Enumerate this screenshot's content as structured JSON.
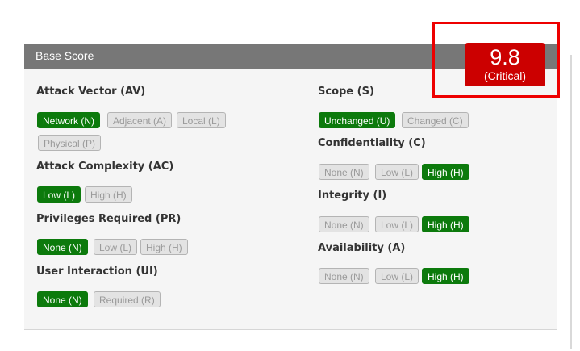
{
  "panel": {
    "title": "Base Score"
  },
  "score": {
    "value": "9.8",
    "severity": "(Critical)"
  },
  "metrics": {
    "attack_vector": {
      "label": "Attack Vector (AV)",
      "options": [
        "Network (N)",
        "Adjacent (A)",
        "Local (L)",
        "Physical (P)"
      ],
      "selected": "Network (N)"
    },
    "attack_complexity": {
      "label": "Attack Complexity (AC)",
      "options": [
        "Low (L)",
        "High (H)"
      ],
      "selected": "Low (L)"
    },
    "privileges_required": {
      "label": "Privileges Required (PR)",
      "options": [
        "None (N)",
        "Low (L)",
        "High (H)"
      ],
      "selected": "None (N)"
    },
    "user_interaction": {
      "label": "User Interaction (UI)",
      "options": [
        "None (N)",
        "Required (R)"
      ],
      "selected": "None (N)"
    },
    "scope": {
      "label": "Scope (S)",
      "options": [
        "Unchanged (U)",
        "Changed (C)"
      ],
      "selected": "Unchanged (U)"
    },
    "confidentiality": {
      "label": "Confidentiality (C)",
      "options": [
        "None (N)",
        "Low (L)",
        "High (H)"
      ],
      "selected": "High (H)"
    },
    "integrity": {
      "label": "Integrity (I)",
      "options": [
        "None (N)",
        "Low (L)",
        "High (H)"
      ],
      "selected": "High (H)"
    },
    "availability": {
      "label": "Availability (A)",
      "options": [
        "None (N)",
        "Low (L)",
        "High (H)"
      ],
      "selected": "High (H)"
    }
  },
  "colors": {
    "selected": "#0c7a0c",
    "unselected": "#e3e3e3",
    "critical": "#cc0000",
    "highlight": "#ee0000",
    "header": "#777777"
  }
}
